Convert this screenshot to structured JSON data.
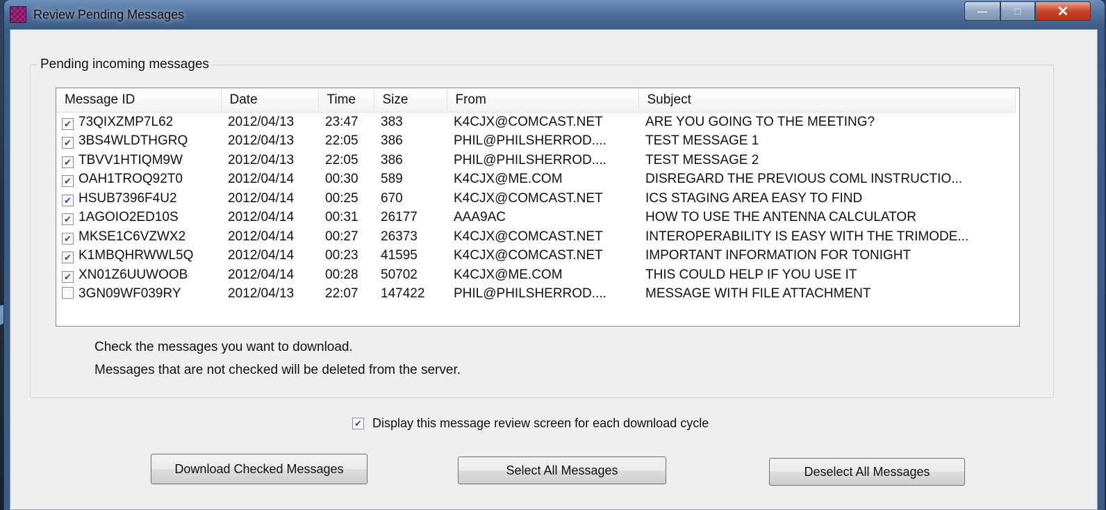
{
  "window": {
    "title": "Review Pending Messages"
  },
  "caption_buttons": {
    "minimize": "—",
    "maximize": "□",
    "close": "✕"
  },
  "group": {
    "label": "Pending incoming messages"
  },
  "columns": [
    "Message ID",
    "Date",
    "Time",
    "Size",
    "From",
    "Subject"
  ],
  "messages": [
    {
      "checked": true,
      "id": "73QIXZMP7L62",
      "date": "2012/04/13",
      "time": "23:47",
      "size": "383",
      "from": "K4CJX@COMCAST.NET",
      "subject": "ARE YOU GOING TO THE MEETING?"
    },
    {
      "checked": true,
      "id": "3BS4WLDTHGRQ",
      "date": "2012/04/13",
      "time": "22:05",
      "size": "386",
      "from": "PHIL@PHILSHERROD....",
      "subject": "TEST MESSAGE 1"
    },
    {
      "checked": true,
      "id": "TBVV1HTIQM9W",
      "date": "2012/04/13",
      "time": "22:05",
      "size": "386",
      "from": "PHIL@PHILSHERROD....",
      "subject": "TEST MESSAGE 2"
    },
    {
      "checked": true,
      "id": "OAH1TROQ92T0",
      "date": "2012/04/14",
      "time": "00:30",
      "size": "589",
      "from": "K4CJX@ME.COM",
      "subject": "DISREGARD THE PREVIOUS COML INSTRUCTIO..."
    },
    {
      "checked": true,
      "id": "HSUB7396F4U2",
      "date": "2012/04/14",
      "time": "00:25",
      "size": "670",
      "from": "K4CJX@COMCAST.NET",
      "subject": "ICS STAGING AREA EASY TO FIND"
    },
    {
      "checked": true,
      "id": "1AGOIO2ED10S",
      "date": "2012/04/14",
      "time": "00:31",
      "size": "26177",
      "from": "AAA9AC",
      "subject": "HOW TO USE THE ANTENNA CALCULATOR"
    },
    {
      "checked": true,
      "id": "MKSE1C6VZWX2",
      "date": "2012/04/14",
      "time": "00:27",
      "size": "26373",
      "from": "K4CJX@COMCAST.NET",
      "subject": "INTEROPERABILITY IS EASY WITH THE TRIMODE..."
    },
    {
      "checked": true,
      "id": "K1MBQHRWWL5Q",
      "date": "2012/04/14",
      "time": "00:23",
      "size": "41595",
      "from": "K4CJX@COMCAST.NET",
      "subject": "IMPORTANT INFORMATION FOR TONIGHT"
    },
    {
      "checked": true,
      "id": "XN01Z6UUWOOB",
      "date": "2012/04/14",
      "time": "00:28",
      "size": "50702",
      "from": "K4CJX@ME.COM",
      "subject": "THIS COULD HELP IF YOU USE IT"
    },
    {
      "checked": false,
      "id": "3GN09WF039RY",
      "date": "2012/04/13",
      "time": "22:07",
      "size": "147422",
      "from": "PHIL@PHILSHERROD....",
      "subject": "MESSAGE WITH FILE ATTACHMENT"
    }
  ],
  "hints": {
    "line1": "Check the messages you want to download.",
    "line2": "Messages that are not checked will be deleted from the server."
  },
  "display_option": {
    "checked": true,
    "label": "Display this message review screen for each download cycle"
  },
  "buttons": {
    "download": "Download Checked Messages",
    "select_all": "Select All Messages",
    "deselect_all": "Deselect All Messages"
  },
  "colors": {
    "titlebar": "#4d6f9a",
    "client": "#efefef",
    "check": "#2d4a8a"
  }
}
